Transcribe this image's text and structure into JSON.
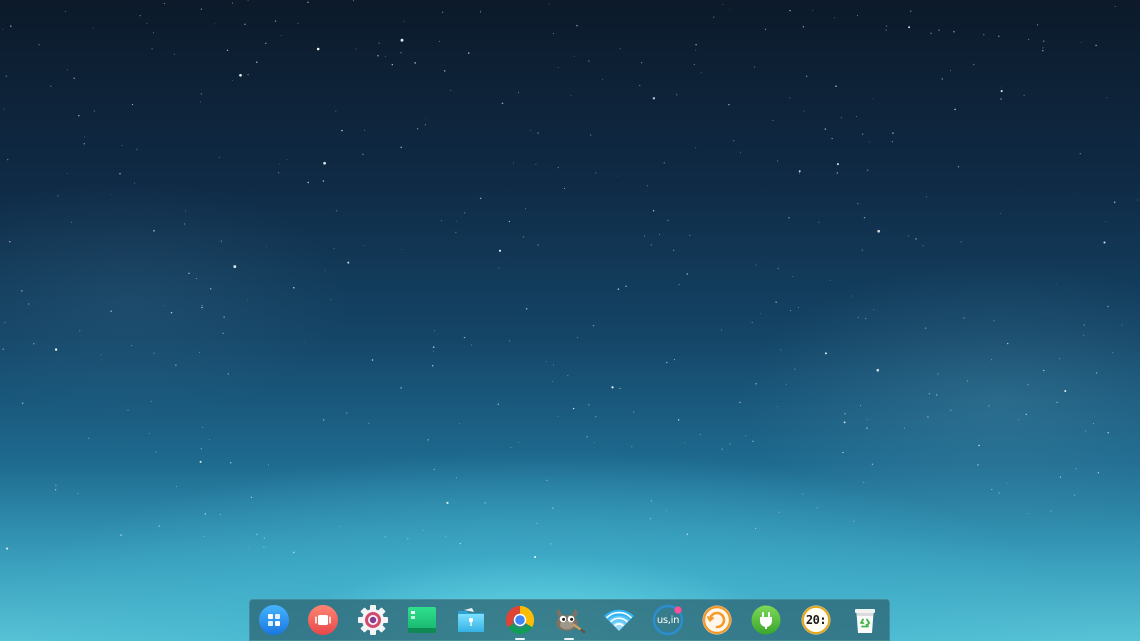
{
  "desktop": {
    "wallpaper": "starry-night-sky"
  },
  "dock": {
    "items": [
      {
        "name": "launcher",
        "icon": "launcher-grid-icon",
        "color": "#2f8fe8"
      },
      {
        "name": "multitasking-view",
        "icon": "multitasking-icon",
        "color": "#f0635a"
      },
      {
        "name": "control-center",
        "icon": "gear-icon",
        "color": "#c94a6b"
      },
      {
        "name": "terminal",
        "icon": "terminal-icon",
        "color": "#1fc27a"
      },
      {
        "name": "file-manager",
        "icon": "folder-icon",
        "color": "#4cc3e8"
      },
      {
        "name": "google-chrome",
        "icon": "chrome-icon",
        "color": "#db4437"
      },
      {
        "name": "gimp",
        "icon": "gimp-icon",
        "color": "#6b6b6b"
      },
      {
        "name": "network",
        "icon": "wifi-icon",
        "color": "#2fb0ef"
      },
      {
        "name": "keyboard-layout",
        "icon": "keyboard-layout-icon",
        "color": "#2a88c8",
        "label": "us,in"
      },
      {
        "name": "power",
        "icon": "refresh-icon",
        "color": "#f59a2b"
      },
      {
        "name": "battery",
        "icon": "plug-icon",
        "color": "#5fbf3a"
      },
      {
        "name": "clock",
        "icon": "clock-icon",
        "color": "#e2a823",
        "label": "20:"
      },
      {
        "name": "trash",
        "icon": "trash-icon",
        "color": "#3fbf4a"
      }
    ]
  }
}
